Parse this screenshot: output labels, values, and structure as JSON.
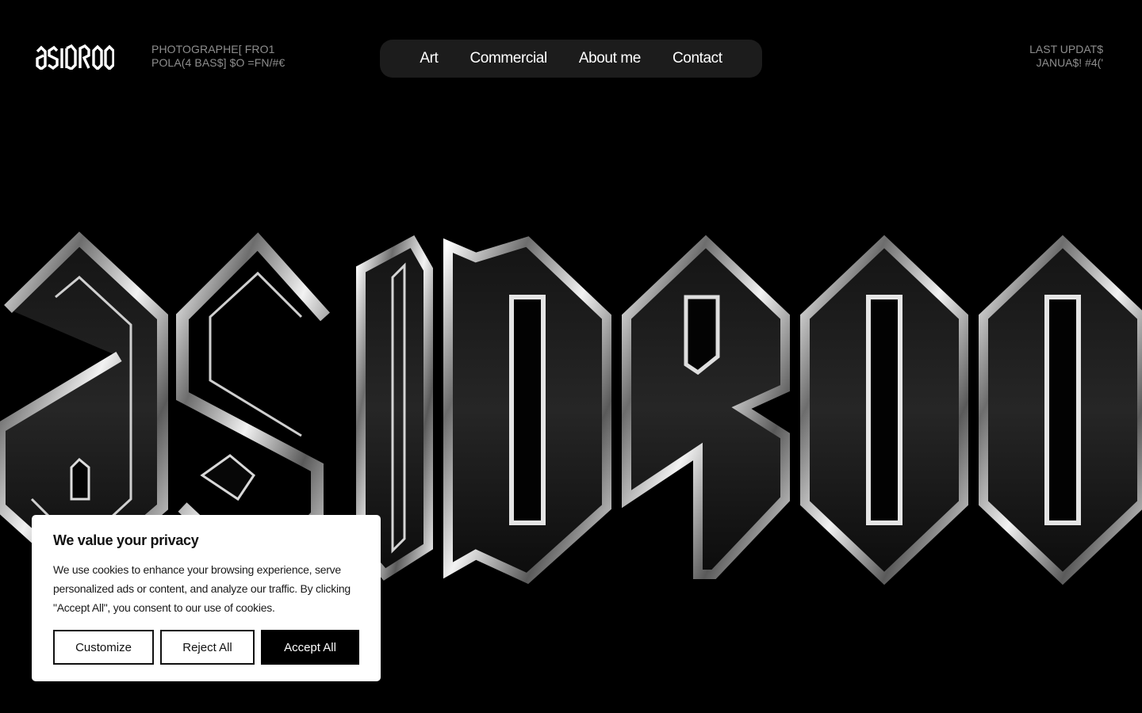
{
  "header": {
    "logo_text": "asidroo",
    "tagline_line1": "PHOTOGRAPHE[ FRO1",
    "tagline_line2": "POLA(4 BAS$] $O =FN/#€",
    "updated_line1": "LAST UPDAT$",
    "updated_line2": "JANUA$! #4('"
  },
  "nav": {
    "items": [
      {
        "label": "Art"
      },
      {
        "label": "Commercial"
      },
      {
        "label": "About me"
      },
      {
        "label": "Contact"
      }
    ]
  },
  "hero": {
    "wordmark": "asidroo"
  },
  "cookie_banner": {
    "title": "We value your privacy",
    "text": "We use cookies to enhance your browsing experience, serve personalized ads or content, and analyze our traffic. By clicking \"Accept All\", you consent to our use of cookies.",
    "customize_label": "Customize",
    "reject_label": "Reject All",
    "accept_label": "Accept All"
  },
  "colors": {
    "background": "#000000",
    "nav_background": "#1c1c1c",
    "muted_text": "#8e8e8e",
    "chrome": "#e8e8e8"
  }
}
